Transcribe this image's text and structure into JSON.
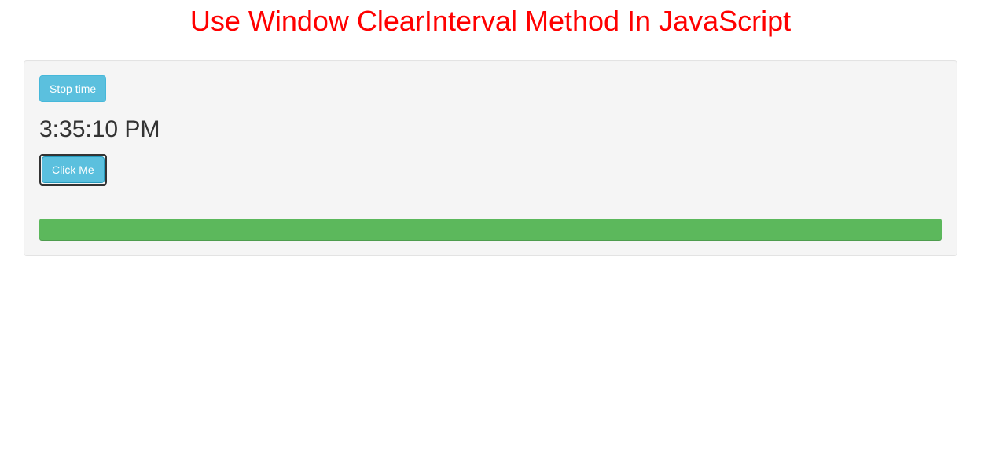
{
  "title": "Use Window ClearInterval Method In JavaScript",
  "buttons": {
    "stop_time_label": "Stop time",
    "click_me_label": "Click Me"
  },
  "time_value": "3:35:10 PM",
  "progress": {
    "color": "#5cb85c",
    "percent": 100
  },
  "colors": {
    "title": "#ff0000",
    "panel_bg": "#f5f5f5",
    "button_info": "#5bc0de",
    "progress_bar": "#5cb85c"
  }
}
